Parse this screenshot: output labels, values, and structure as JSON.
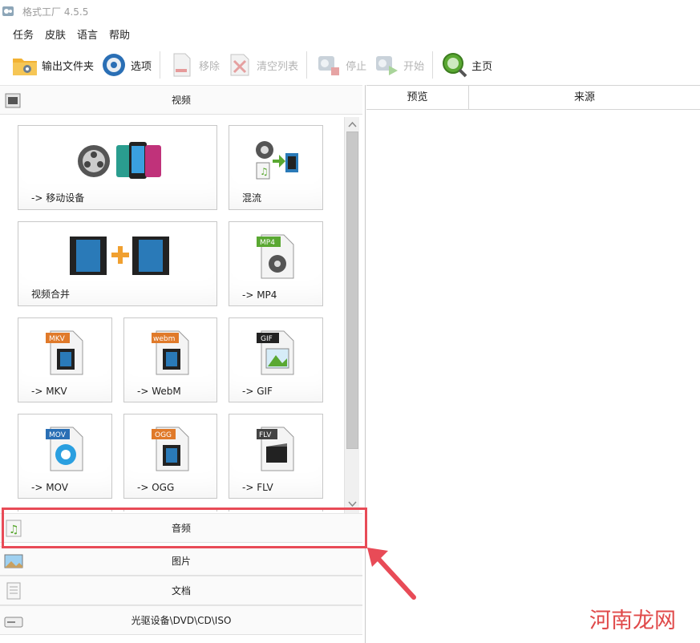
{
  "window": {
    "title": "格式工厂 4.5.5"
  },
  "menu": {
    "items": [
      "任务",
      "皮肤",
      "语言",
      "帮助"
    ]
  },
  "toolbar": {
    "output_folder": "输出文件夹",
    "options": "选项",
    "remove": "移除",
    "clear_list": "清空列表",
    "stop": "停止",
    "start": "开始",
    "home": "主页"
  },
  "categories": {
    "video": "视频",
    "audio": "音频",
    "image": "图片",
    "document": "文档",
    "rom": "光驱设备\\DVD\\CD\\ISO"
  },
  "video_tiles": [
    {
      "label": "-> 移动设备"
    },
    {
      "label": "混流"
    },
    {
      "label": "视频合并"
    },
    {
      "label": "-> MP4",
      "badge": "MP4"
    },
    {
      "label": "-> MKV",
      "badge": "MKV"
    },
    {
      "label": "-> WebM",
      "badge": "webm"
    },
    {
      "label": "-> GIF",
      "badge": "GIF"
    },
    {
      "label": "-> MOV",
      "badge": "MOV"
    },
    {
      "label": "-> OGG",
      "badge": "OGG"
    },
    {
      "label": "-> FLV",
      "badge": "FLV"
    }
  ],
  "task_list": {
    "columns": [
      "预览",
      "来源"
    ]
  },
  "watermark": "河南龙网",
  "colors": {
    "highlight": "#e84b57",
    "accent_green": "#5aa832",
    "orange": "#f0a030"
  }
}
